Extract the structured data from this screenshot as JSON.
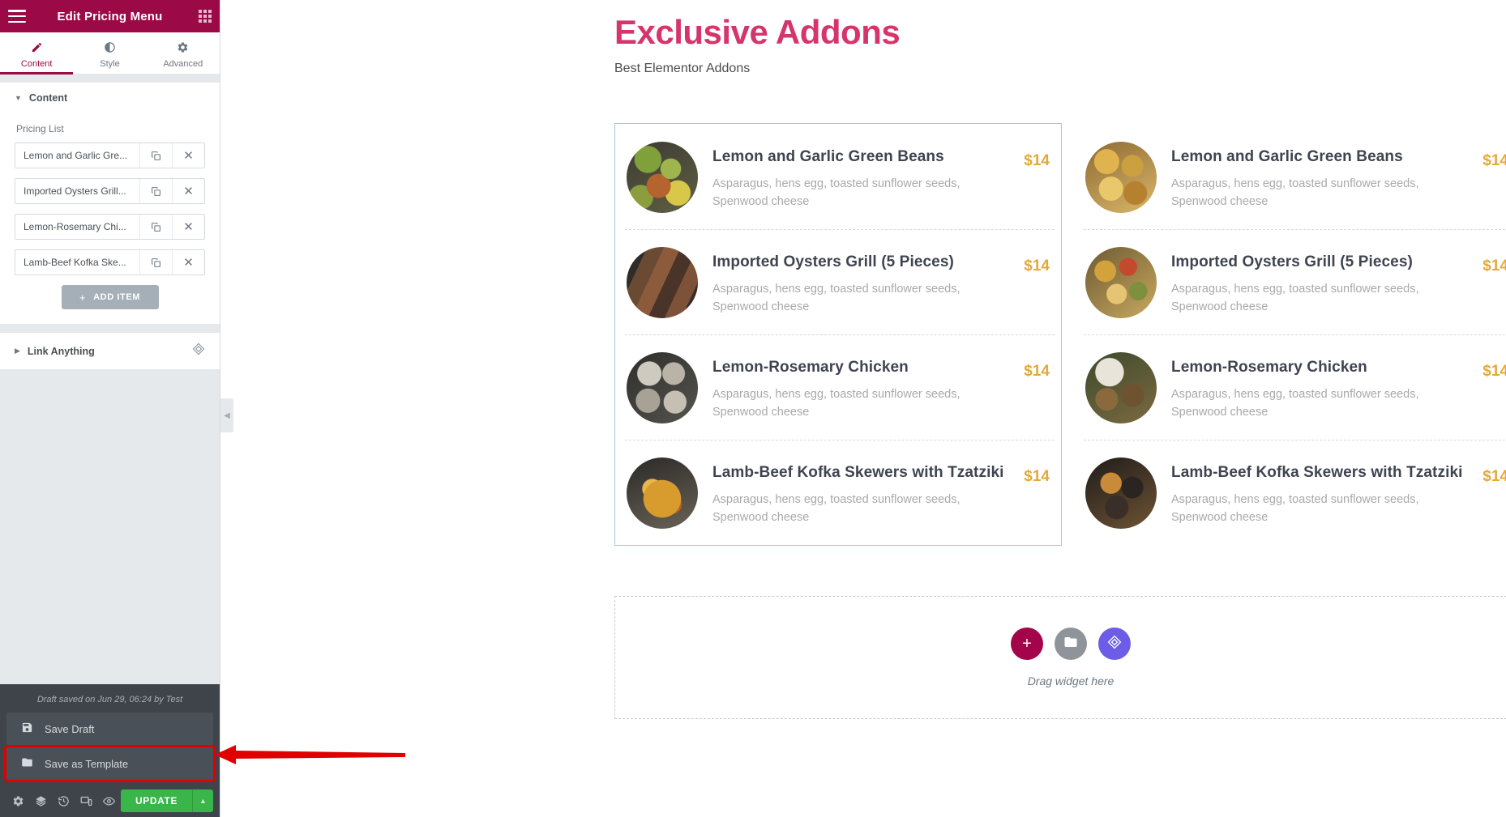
{
  "sidebar": {
    "header": {
      "title": "Edit Pricing Menu",
      "menu_icon": "hamburger-icon",
      "grid_icon": "grid-icon"
    },
    "tabs": [
      {
        "label": "Content",
        "icon": "pencil-icon",
        "active": true
      },
      {
        "label": "Style",
        "icon": "contrast-icon",
        "active": false
      },
      {
        "label": "Advanced",
        "icon": "gear-icon",
        "active": false
      }
    ],
    "content_section": {
      "title": "Content",
      "field_label": "Pricing List",
      "items": [
        {
          "title": "Lemon and Garlic Gre..."
        },
        {
          "title": "Imported Oysters Grill..."
        },
        {
          "title": "Lemon-Rosemary Chi..."
        },
        {
          "title": "Lamb-Beef Kofka Ske..."
        }
      ],
      "add_item_label": "ADD ITEM",
      "add_item_plus": "+",
      "duplicate_icon": "copy-icon",
      "remove_icon": "close-icon"
    },
    "link_section": {
      "title": "Link Anything",
      "icon": "exclusive-addons-icon"
    },
    "footer": {
      "draft_note": "Draft saved on Jun 29, 06:24 by Test",
      "save_draft_label": "Save Draft",
      "save_draft_icon": "floppy-disk-icon",
      "save_template_label": "Save as Template",
      "save_template_icon": "folder-icon",
      "toolbar_icons": [
        "gear-icon",
        "layers-icon",
        "history-icon",
        "responsive-icon",
        "eye-icon"
      ],
      "update_label": "UPDATE",
      "update_caret": "▲"
    },
    "collapse_handle": {
      "icon": "chevron-left-icon",
      "glyph": "◀"
    }
  },
  "colors": {
    "brand": "#9b0a46",
    "title_pink": "#d6356b",
    "price_gold": "#e2a93b",
    "update_green": "#39b54a",
    "annotation_red": "#e00000",
    "selected_outline": "#a4c6e0"
  },
  "canvas": {
    "page_title": "Exclusive Addons",
    "page_subtitle": "Best Elementor Addons",
    "columns": [
      {
        "selected": true,
        "items": [
          {
            "title": "Lemon and Garlic Green Beans",
            "description": "Asparagus, hens egg, toasted sunflower seeds, Spenwood cheese",
            "price": "$14",
            "thumb": "green-beans-salad-photo"
          },
          {
            "title": "Imported Oysters Grill (5 Pieces)",
            "description": "Asparagus, hens egg, toasted sunflower seeds, Spenwood cheese",
            "price": "$14",
            "thumb": "grilled-meat-photo"
          },
          {
            "title": "Lemon-Rosemary Chicken",
            "description": "Asparagus, hens egg, toasted sunflower seeds, Spenwood cheese",
            "price": "$14",
            "thumb": "oysters-platter-photo"
          },
          {
            "title": "Lamb-Beef Kofka Skewers with Tzatziki",
            "description": "Asparagus, hens egg, toasted sunflower seeds, Spenwood cheese",
            "price": "$14",
            "thumb": "pasta-bowl-photo"
          }
        ]
      },
      {
        "selected": false,
        "items": [
          {
            "title": "Lemon and Garlic Green Beans",
            "description": "Asparagus, hens egg, toasted sunflower seeds, Spenwood cheese",
            "price": "$14",
            "thumb": "roasted-potatoes-photo"
          },
          {
            "title": "Imported Oysters Grill (5 Pieces)",
            "description": "Asparagus, hens egg, toasted sunflower seeds, Spenwood cheese",
            "price": "$14",
            "thumb": "paella-photo"
          },
          {
            "title": "Lemon-Rosemary Chicken",
            "description": "Asparagus, hens egg, toasted sunflower seeds, Spenwood cheese",
            "price": "$14",
            "thumb": "kofta-skewers-photo"
          },
          {
            "title": "Lamb-Beef Kofka Skewers with Tzatziki",
            "description": "Asparagus, hens egg, toasted sunflower seeds, Spenwood cheese",
            "price": "$14",
            "thumb": "grilled-eggplant-photo"
          }
        ]
      }
    ],
    "drop_zone": {
      "text": "Drag widget here",
      "add_icon": "plus-icon",
      "folder_icon": "folder-icon",
      "addons_icon": "exclusive-addons-icon"
    }
  }
}
